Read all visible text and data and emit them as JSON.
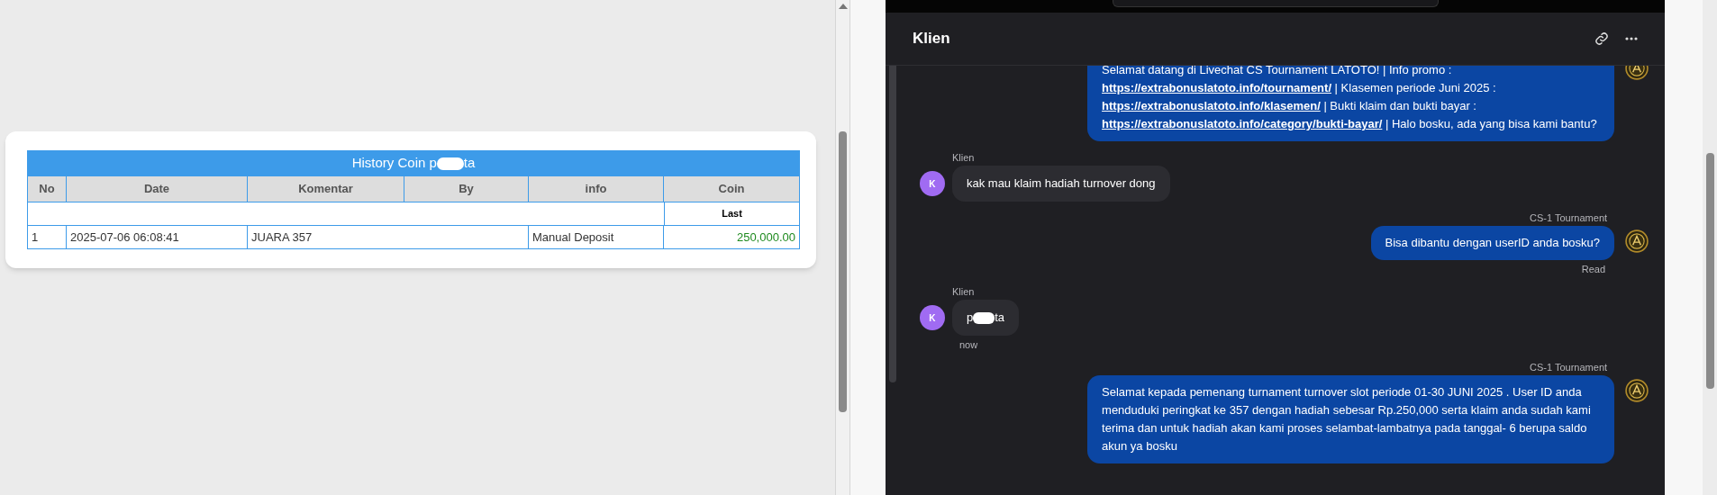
{
  "history_table": {
    "title_parts": [
      {
        "kind": "text",
        "text": "History Coin p"
      },
      {
        "kind": "redaction"
      },
      {
        "kind": "text",
        "text": "ta"
      }
    ],
    "columns": [
      "No",
      "Date",
      "Komentar",
      "By",
      "info",
      "Coin"
    ],
    "subheader": {
      "coin": "Last"
    },
    "rows": [
      {
        "no": "1",
        "date": "2025-07-06 06:08:41",
        "komentar": "JUARA 357",
        "info": "Manual Deposit",
        "coin": "250,000.00"
      }
    ]
  },
  "chat": {
    "title": "Klien",
    "messages": [
      {
        "kind": "agent",
        "segments": [
          {
            "kind": "text",
            "text": "Selamat datang di Livechat CS Tournament LATOTO! | Info promo : "
          },
          {
            "kind": "link",
            "text": "https://extrabonuslatoto.info/tournament/"
          },
          {
            "kind": "text",
            "text": " | Klasemen periode Juni 2025 : "
          },
          {
            "kind": "link",
            "text": "https://extrabonuslatoto.info/klasemen/"
          },
          {
            "kind": "text",
            "text": " | Bukti klaim dan bukti bayar : "
          },
          {
            "kind": "link",
            "text": "https://extrabonuslatoto.info/category/bukti-bayar/"
          },
          {
            "kind": "text",
            "text": " | Halo bosku, ada yang bisa kami bantu?"
          }
        ]
      },
      {
        "kind": "client",
        "sender": "Klien",
        "avatar": "K",
        "segments": [
          {
            "kind": "text",
            "text": "kak mau klaim hadiah turnover dong"
          }
        ]
      },
      {
        "kind": "agent",
        "sender": "CS-1 Tournament",
        "segments": [
          {
            "kind": "text",
            "text": "Bisa dibantu dengan userID anda bosku?"
          }
        ],
        "status": "Read"
      },
      {
        "kind": "client",
        "sender": "Klien",
        "avatar": "K",
        "segments": [
          {
            "kind": "text",
            "text": "p"
          },
          {
            "kind": "redaction"
          },
          {
            "kind": "text",
            "text": "ta"
          }
        ],
        "status": "now"
      },
      {
        "kind": "agent",
        "sender": "CS-1 Tournament",
        "segments": [
          {
            "kind": "text",
            "text": "Selamat kepada pemenang turnament turnover slot periode 01-30 JUNI 2025 . User ID anda menduduki peringkat ke 357 dengan hadiah sebesar Rp.250,000 serta klaim anda sudah kami terima dan untuk hadiah akan kami proses selambat-lambatnya pada tanggal- 6 berupa saldo akun ya bosku"
          }
        ]
      }
    ]
  }
}
